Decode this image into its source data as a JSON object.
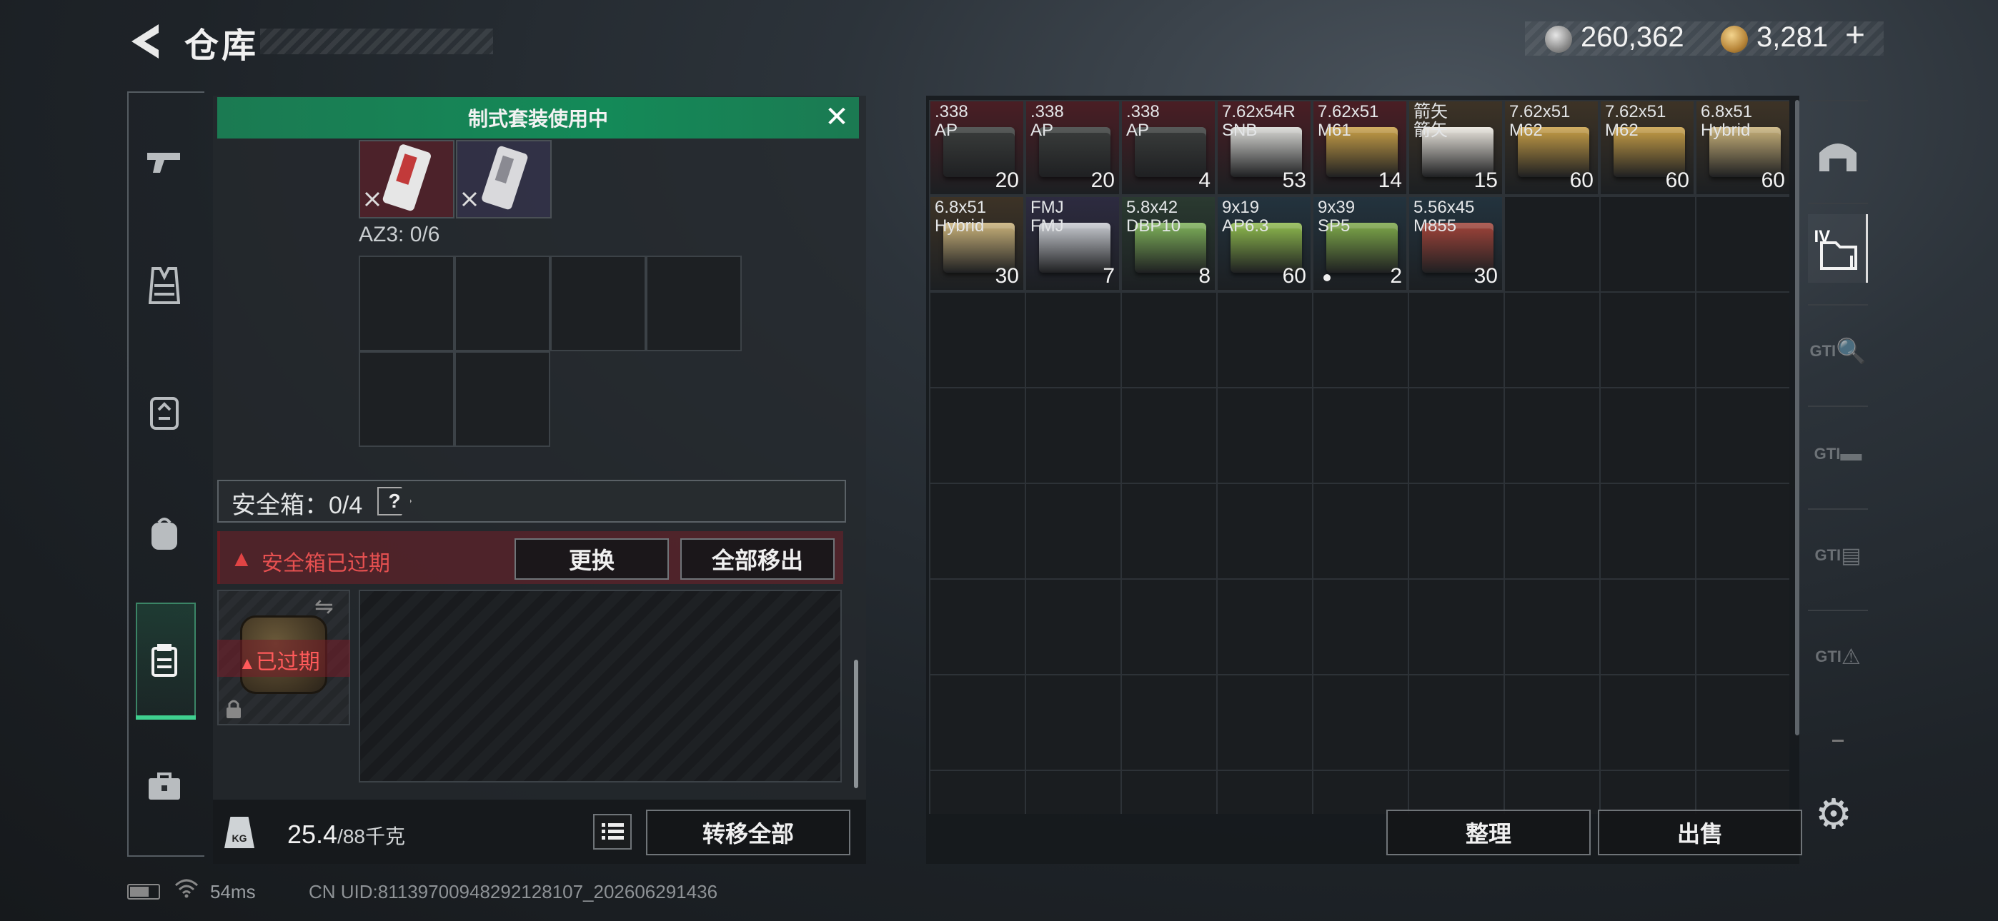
{
  "header": {
    "title": "仓库",
    "currency_silver": "260,362",
    "currency_gold": "3,281",
    "add_symbol": "+"
  },
  "left_nav": {
    "icons": [
      "pistol-icon",
      "vest-icon",
      "armor-icon",
      "backpack-icon",
      "safe-case-icon",
      "toolbox-icon"
    ]
  },
  "loadout": {
    "banner": "制式套装使用中",
    "az3_label": "AZ3: 0/6",
    "safe_box_label": "安全箱：0/4",
    "help_symbol": "?",
    "warning_text": "安全箱已过期",
    "swap_button": "更换",
    "move_all_button": "全部移出",
    "expired_badge": "已过期"
  },
  "footer": {
    "weight_current": "25.4",
    "weight_max": "/88千克",
    "transfer_all_button": "转移全部",
    "sort_button": "整理",
    "sell_button": "出售"
  },
  "stash": {
    "items": [
      {
        "name": ".338\nAP",
        "qty": "20",
        "bg": "#4a1e24",
        "box": "#3a3d3c"
      },
      {
        "name": ".338\nAP",
        "qty": "20",
        "bg": "#4a1e24",
        "box": "#3a3d3c"
      },
      {
        "name": ".338\nAP",
        "qty": "4",
        "bg": "#4a1e24",
        "box": "#3a3d3c"
      },
      {
        "name": "7.62x54R\nSNB",
        "qty": "53",
        "bg": "#4a1e24",
        "box": "#d8d8d4"
      },
      {
        "name": "7.62x51\nM61",
        "qty": "14",
        "bg": "#4a1e24",
        "box": "#c9a047"
      },
      {
        "name": "箭矢\n箭矢",
        "qty": "15",
        "bg": "#3d3326",
        "box": "#ebe7df"
      },
      {
        "name": "7.62x51\nM62",
        "qty": "60",
        "bg": "#3d3326",
        "box": "#c9a047"
      },
      {
        "name": "7.62x51\nM62",
        "qty": "60",
        "bg": "#3d3326",
        "box": "#c9a047"
      },
      {
        "name": "6.8x51\nHybrid",
        "qty": "60",
        "bg": "#3d3326",
        "box": "#c9b27a"
      },
      {
        "name": "6.8x51\nHybrid",
        "qty": "30",
        "bg": "#3d3326",
        "box": "#c9b27a"
      },
      {
        "name": "FMJ\nFMJ",
        "qty": "7",
        "bg": "#2d2b40",
        "box": "#c9ccd2"
      },
      {
        "name": "5.8x42\nDBP10",
        "qty": "8",
        "bg": "#2a3a30",
        "box": "#7fb25a"
      },
      {
        "name": "9x19\nAP6.3",
        "qty": "60",
        "bg": "#23333e",
        "box": "#8fbb4e"
      },
      {
        "name": "9x39\nSP5",
        "qty": "2",
        "bg": "#23333e",
        "box": "#7faa4a",
        "mark": true
      },
      {
        "name": "5.56x45\nM855",
        "qty": "30",
        "bg": "#23333e",
        "box": "#a2443a"
      }
    ]
  },
  "right_nav": {
    "tabs": [
      "GTI",
      "GTI",
      "GTI",
      "GTI"
    ],
    "active_tab": "IV"
  },
  "status": {
    "ping": "54ms",
    "uid": "CN UID:8113970094829212810​7_202606291436"
  }
}
